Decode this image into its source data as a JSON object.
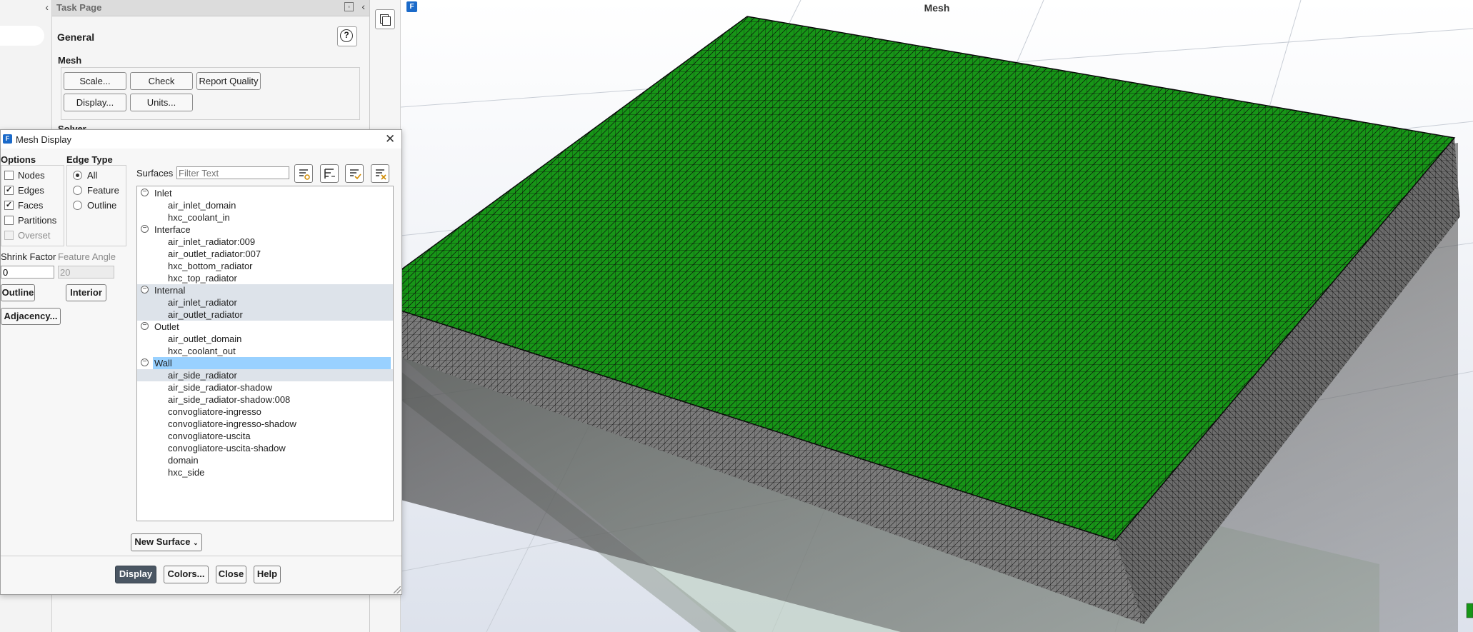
{
  "outline": {
    "collapse_glyph": "‹"
  },
  "task_page": {
    "header_title": "Task Page",
    "section_title": "General",
    "mesh_group_title": "Mesh",
    "buttons": {
      "scale": "Scale...",
      "check": "Check",
      "report_quality": "Report Quality",
      "display": "Display...",
      "units": "Units..."
    },
    "solver_partial_label": "Solver"
  },
  "viewport": {
    "title": "Mesh",
    "logo": "F",
    "mesh_colors": {
      "top_face": "#179617",
      "side_face": "#6f6f6f",
      "mesh_lines": "#0b0b0b"
    }
  },
  "dialog": {
    "title": "Mesh Display",
    "logo": "F",
    "options": {
      "title": "Options",
      "items": [
        {
          "label": "Nodes",
          "checked": false,
          "disabled": false
        },
        {
          "label": "Edges",
          "checked": true,
          "disabled": false
        },
        {
          "label": "Faces",
          "checked": true,
          "disabled": false
        },
        {
          "label": "Partitions",
          "checked": false,
          "disabled": false
        },
        {
          "label": "Overset",
          "checked": false,
          "disabled": true
        }
      ]
    },
    "edge_type": {
      "title": "Edge Type",
      "items": [
        {
          "label": "All",
          "selected": true
        },
        {
          "label": "Feature",
          "selected": false
        },
        {
          "label": "Outline",
          "selected": false
        }
      ]
    },
    "shrink_factor": {
      "label": "Shrink Factor",
      "value": "0"
    },
    "feature_angle": {
      "label": "Feature Angle",
      "value": "20"
    },
    "buttons": {
      "outline": "Outline",
      "interior": "Interior",
      "adjacency": "Adjacency..."
    },
    "surfaces": {
      "label": "Surfaces",
      "filter_placeholder": "Filter Text",
      "groups": [
        {
          "name": "Inlet",
          "items": [
            "air_inlet_domain",
            "hxc_coolant_in"
          ]
        },
        {
          "name": "Interface",
          "items": [
            "air_inlet_radiator:009",
            "air_outlet_radiator:007",
            "hxc_bottom_radiator",
            "hxc_top_radiator"
          ]
        },
        {
          "name": "Internal",
          "items": [
            "air_inlet_radiator",
            "air_outlet_radiator"
          ]
        },
        {
          "name": "Outlet",
          "items": [
            "air_outlet_domain",
            "hxc_coolant_out"
          ]
        },
        {
          "name": "Wall",
          "items": [
            "air_side_radiator",
            "air_side_radiator-shadow",
            "air_side_radiator-shadow:008",
            "convogliatore-ingresso",
            "convogliatore-ingresso-shadow",
            "convogliatore-uscita",
            "convogliatore-uscita-shadow",
            "domain",
            "hxc_side"
          ]
        }
      ],
      "collapse_glyph": "−"
    },
    "new_surface_label": "New Surface",
    "footer_buttons": {
      "display": "Display",
      "colors": "Colors...",
      "close": "Close",
      "help": "Help"
    }
  }
}
